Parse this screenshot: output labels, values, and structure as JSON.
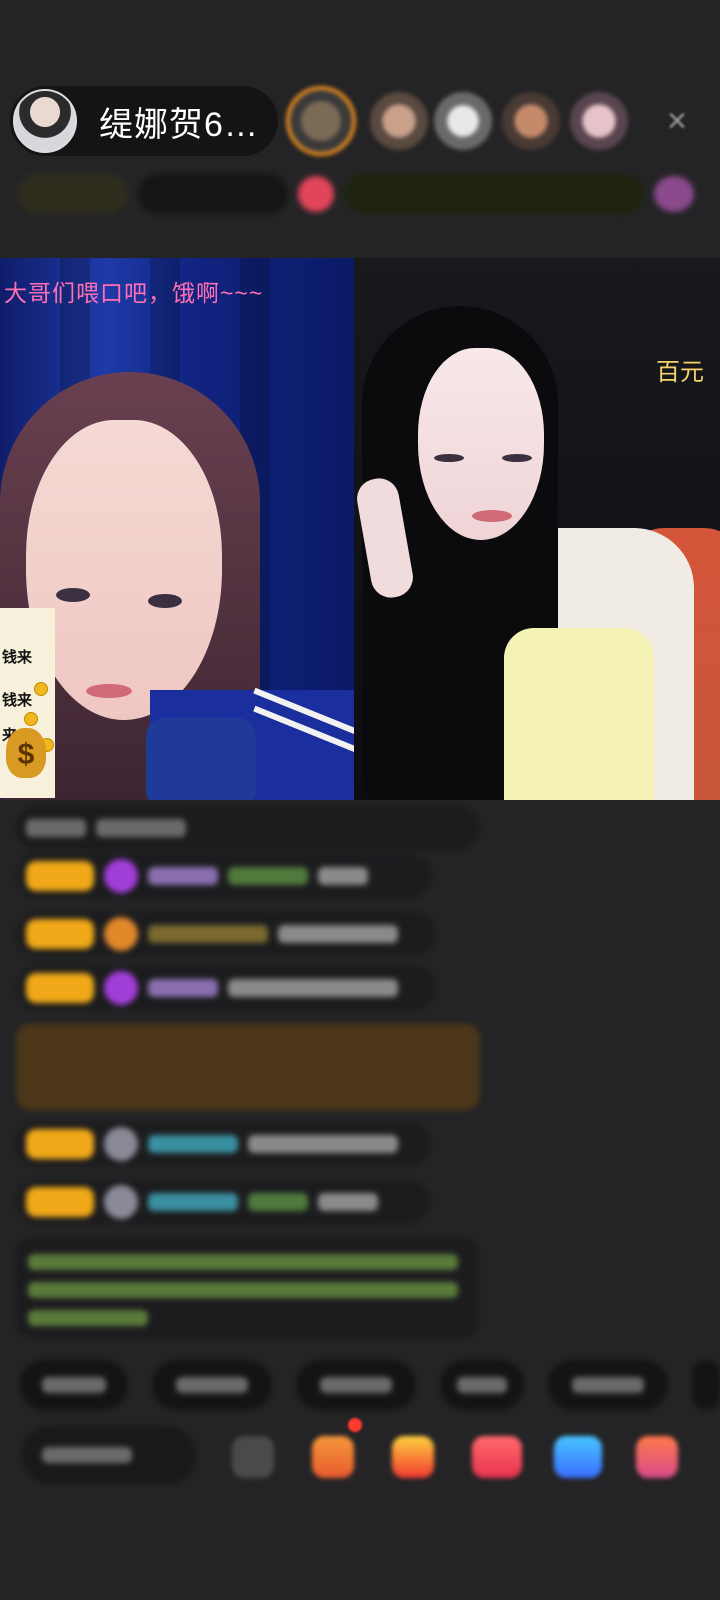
{
  "header": {
    "host_name": "缇娜贺6…",
    "close_icon": "×",
    "viewer_avatars": [
      "viewer-avatar",
      "viewer-avatar",
      "viewer-avatar",
      "viewer-avatar",
      "viewer-avatar"
    ]
  },
  "stream": {
    "left_caption": "大哥们喂口吧，饿啊~~~",
    "left_sticker_lines": [
      "钱来",
      "钱来",
      "来"
    ],
    "left_sticker_symbol": "$",
    "right_caption": "百元"
  },
  "colors": {
    "background": "#242426",
    "caption_pink": "#ff6fb2",
    "caption_gold": "#f5d36a",
    "level_badge": "#f0a818"
  }
}
